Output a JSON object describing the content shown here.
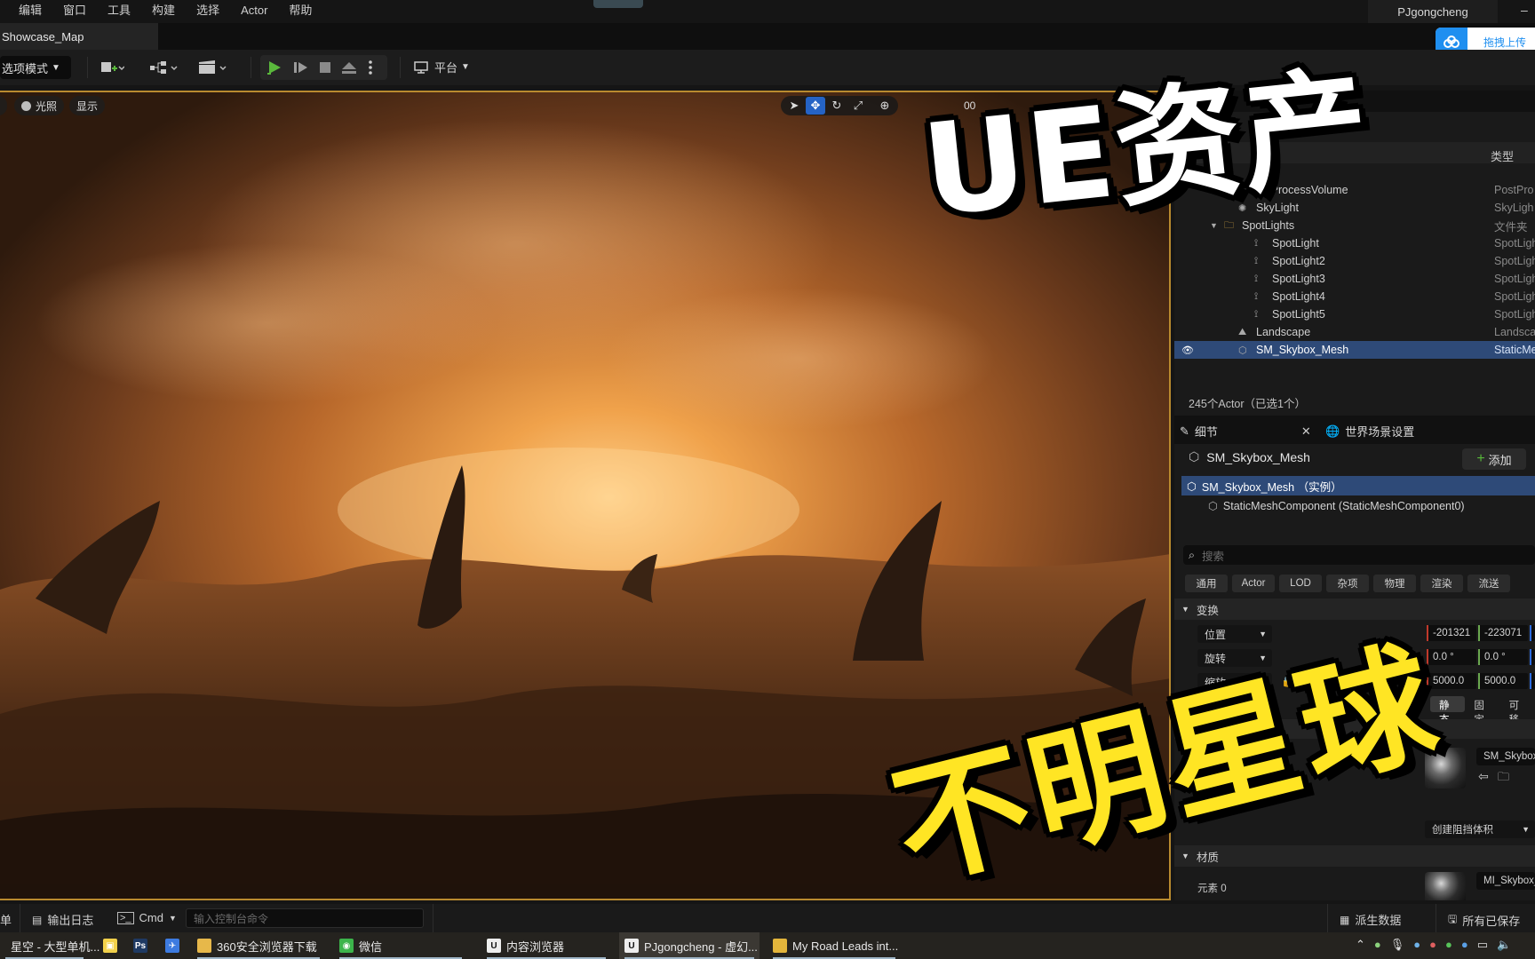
{
  "menu": [
    "编辑",
    "窗口",
    "工具",
    "构建",
    "选择",
    "Actor",
    "帮助"
  ],
  "user_name": "PJgongcheng",
  "map_tab": "Showcase_Map",
  "upload_label": "拖拽上传",
  "toolbar": {
    "mode_label": "选项模式",
    "platform_label": "平台"
  },
  "viewport": {
    "lighting_btn": "光照",
    "show_btn": "显示",
    "tools": [
      "select-icon",
      "move-icon",
      "rotate-icon",
      "scale-icon",
      "globe-icon"
    ],
    "partial_label": "00"
  },
  "outliner": {
    "col_type": "类型",
    "rows": [
      {
        "name": "ostProcessVolume",
        "type": "PostPro",
        "indent": 1,
        "icon": "cube-icon"
      },
      {
        "name": "SkyLight",
        "type": "SkyLigh",
        "indent": 1,
        "icon": "light-icon"
      },
      {
        "name": "SpotLights",
        "type": "文件夹",
        "indent": 0,
        "icon": "folder-icon"
      },
      {
        "name": "SpotLight",
        "type": "SpotLigh",
        "indent": 2,
        "icon": "spotlight-icon"
      },
      {
        "name": "SpotLight2",
        "type": "SpotLigh",
        "indent": 2,
        "icon": "spotlight-icon"
      },
      {
        "name": "SpotLight3",
        "type": "SpotLigh",
        "indent": 2,
        "icon": "spotlight-icon"
      },
      {
        "name": "SpotLight4",
        "type": "SpotLigh",
        "indent": 2,
        "icon": "spotlight-icon"
      },
      {
        "name": "SpotLight5",
        "type": "SpotLigh",
        "indent": 2,
        "icon": "spotlight-icon"
      },
      {
        "name": "Landscape",
        "type": "Landsca",
        "indent": 1,
        "icon": "landscape-icon"
      },
      {
        "name": "SM_Skybox_Mesh",
        "type": "StaticMe",
        "indent": 1,
        "icon": "mesh-icon",
        "selected": true
      }
    ],
    "status": "245个Actor（已选1个）"
  },
  "details": {
    "tab_details": "细节",
    "tab_world": "世界场景设置",
    "actor_name": "SM_Skybox_Mesh",
    "add_label": "添加",
    "component_root": "SM_Skybox_Mesh （实例）",
    "component_child": "StaticMeshComponent (StaticMeshComponent0)",
    "search_placeholder": "搜索",
    "filters": [
      "通用",
      "Actor",
      "LOD",
      "杂项",
      "物理",
      "渲染",
      "流送"
    ],
    "transform_label": "变换",
    "location_label": "位置",
    "rotation_label": "旋转",
    "scale_label": "缩放",
    "location_values": [
      "-201321",
      "-223071"
    ],
    "rotation_values": [
      "0.0 °",
      "0.0 °"
    ],
    "scale_values": [
      "5000.0",
      "5000.0"
    ],
    "mobility_label": "移动性",
    "mobility_options": [
      "静态",
      "固定",
      "可移"
    ],
    "static_mesh_name": "SM_Skybox",
    "collision_label": "创建阻挡体积",
    "materials_label": "材质",
    "element_label": "元素 0",
    "material_name": "MI_Skybox_"
  },
  "statusbar": {
    "left_cut": "单",
    "output_log": "输出日志",
    "cmd_label": "Cmd",
    "console_placeholder": "输入控制台命令",
    "derived_data": "派生数据",
    "saved_label": "所有已保存"
  },
  "taskbar": [
    {
      "label": "星空 - 大型单机...",
      "icon": "game-icon"
    },
    {
      "label": "",
      "icon": "note-icon"
    },
    {
      "label": "",
      "icon": "photoshop-icon"
    },
    {
      "label": "",
      "icon": "bird-icon"
    },
    {
      "label": "360安全浏览器下载",
      "icon": "folder-icon"
    },
    {
      "label": "微信",
      "icon": "wechat-icon"
    },
    {
      "label": "内容浏览器",
      "icon": "unreal-icon"
    },
    {
      "label": "PJgongcheng - 虚幻...",
      "icon": "unreal-icon",
      "active": true
    },
    {
      "label": "My Road Leads int...",
      "icon": "chrome-icon"
    }
  ],
  "overlay": {
    "title_top": "UE资产",
    "title_bottom": "不明星球"
  },
  "colors": {
    "accent_blue": "#2e4a78",
    "viewport_border": "#b98a2f",
    "title_yellow": "#ffe524"
  }
}
